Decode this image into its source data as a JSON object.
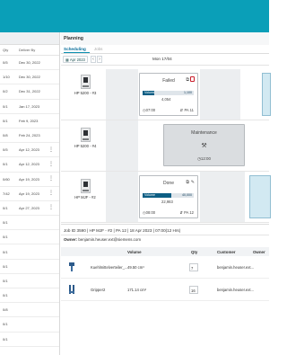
{
  "left_table": {
    "col_qty": "Qty",
    "col_deliver_by": "Deliver By",
    "rows": [
      {
        "qty": "0/5",
        "date": "Dec 30, 2022"
      },
      {
        "qty": "1/10",
        "date": "Dec 30, 2022"
      },
      {
        "qty": "0/2",
        "date": "Dec 31, 2022"
      },
      {
        "qty": "0/1",
        "date": "Jan 17, 2023"
      },
      {
        "qty": "0/1",
        "date": "Feb 9, 2023"
      },
      {
        "qty": "0/8",
        "date": "Feb 24, 2023"
      },
      {
        "qty": "0/5",
        "date": "Apr 12, 2023"
      },
      {
        "qty": "0/1",
        "date": "Apr 12, 2023"
      },
      {
        "qty": "0/60",
        "date": "Apr 19, 2023"
      },
      {
        "qty": "7/42",
        "date": "Apr 19, 2023"
      },
      {
        "qty": "0/1",
        "date": "Apr 27, 2023"
      },
      {
        "qty": "0/1",
        "date": ""
      },
      {
        "qty": "0/1",
        "date": ""
      },
      {
        "qty": "0/1",
        "date": ""
      },
      {
        "qty": "0/1",
        "date": ""
      },
      {
        "qty": "0/1",
        "date": ""
      },
      {
        "qty": "0/1",
        "date": ""
      },
      {
        "qty": "0/8",
        "date": ""
      },
      {
        "qty": "0/1",
        "date": ""
      },
      {
        "qty": "0/1",
        "date": ""
      }
    ]
  },
  "planning": {
    "title": "Planning",
    "tabs": [
      "Scheduling",
      "Jobs"
    ],
    "date_button": "Apr 2023",
    "prev": "‹",
    "next": "›",
    "day_label": "Mon 17/04",
    "printers": [
      {
        "name": "HP 5200 - #3"
      },
      {
        "name": "HP 5200 - #4"
      },
      {
        "name": "HP MJF - #2"
      }
    ],
    "cards": {
      "failed": {
        "status": "Failed",
        "volume_label": "Volume",
        "volume_value": "1,100",
        "sub_value": "4,054",
        "start_time": "07:00",
        "pa": "PA 11",
        "fill_pct": 23
      },
      "maintenance": {
        "status": "Maintenance",
        "time": "12:00"
      },
      "done": {
        "status": "Done",
        "volume_label": "Volume",
        "volume_value": "40,000",
        "sub_value": "22,983",
        "start_time": "08:00",
        "pa": "PA 12",
        "fill_pct": 57
      }
    }
  },
  "job": {
    "summary": "Job ID 3590 | HP MJF - #2 | PA 12 | 18 Apr 2023 | 07:00(12 Hrs)",
    "owner_label": "Owner:",
    "owner_email": "benjamin.heuser.ext@siemens.com",
    "columns": {
      "volume": "Volume",
      "qty": "Qty",
      "customer": "Customer",
      "owner": "Owner"
    },
    "rows": [
      {
        "name": "Kuehlmittelverteiler_...",
        "volume": "49.50 cm³",
        "qty": "7",
        "customer": "",
        "owner": "benjamin.heuser.ext..."
      },
      {
        "name": "Gripper2",
        "volume": "171.14 cm³",
        "qty": "16",
        "customer": "",
        "owner": "benjamin.heuser.ext..."
      }
    ]
  },
  "colors": {
    "topbar": "#0a9fb8",
    "accent": "#0d5e84",
    "failed": "#c81d2a"
  }
}
